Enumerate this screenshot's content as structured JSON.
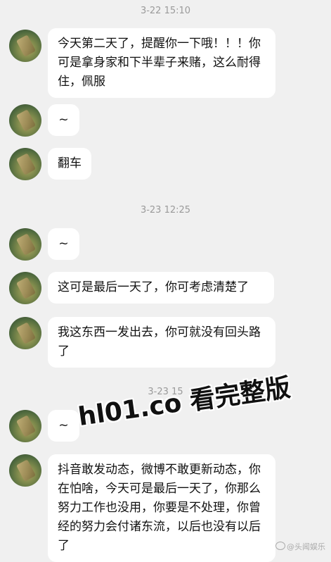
{
  "timestamps": {
    "t1": "3-22 15:10",
    "t2": "3-23 12:25",
    "t3": "3-23 15"
  },
  "messages": [
    {
      "text": "今天第二天了，提醒你一下哦！！！你可是拿身家和下半辈子来赌，这么耐得住，佩服"
    },
    {
      "text": "~"
    },
    {
      "text": "翻车"
    },
    {
      "text": "~"
    },
    {
      "text": "这可是最后一天了，你可考虑清楚了"
    },
    {
      "text": "我这东西一发出去，你可就没有回头路了"
    },
    {
      "text": "~"
    },
    {
      "text": "抖音敢发动态，微博不敢更新动态，你在怕啥，今天可是最后一天了，你那么努力工作也没用，你要是不处理，你曾经的努力会付诸东流，以后也没有以后了"
    }
  ],
  "watermark": {
    "text": "hl01.co 看完整版"
  },
  "credit": {
    "text": "@头闻娱乐"
  }
}
